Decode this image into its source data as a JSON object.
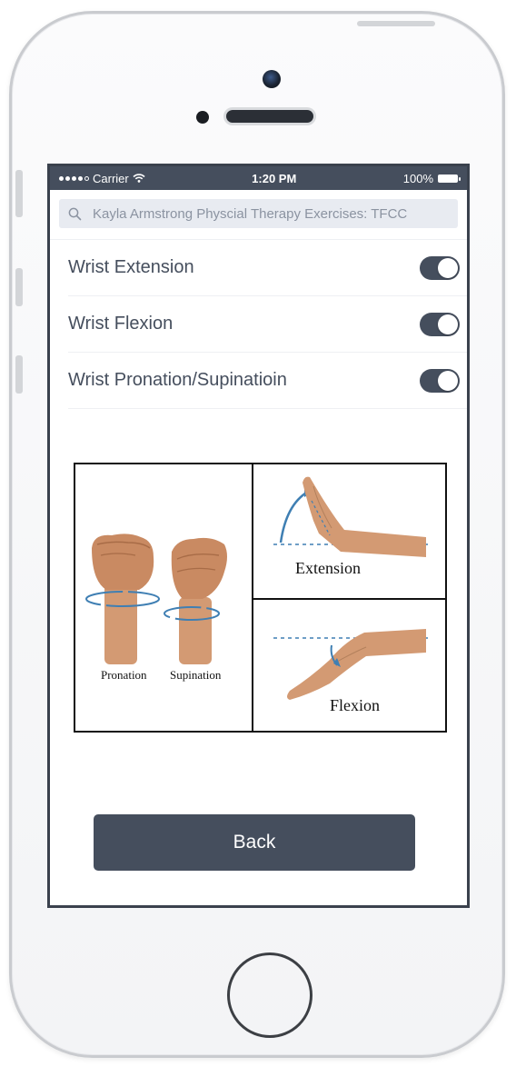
{
  "status_bar": {
    "carrier": "Carrier",
    "time": "1:20 PM",
    "battery": "100%"
  },
  "search": {
    "placeholder": "Kayla Armstrong Physcial Therapy Exercises: TFCC"
  },
  "exercises": [
    {
      "label": "Wrist Extension",
      "enabled": true
    },
    {
      "label": "Wrist Flexion",
      "enabled": true
    },
    {
      "label": "Wrist Pronation/Supinatioin",
      "enabled": true
    }
  ],
  "figure": {
    "pronation_label": "Pronation",
    "supination_label": "Supination",
    "extension_label": "Extension",
    "flexion_label": "Flexion"
  },
  "actions": {
    "back_label": "Back"
  },
  "colors": {
    "primary": "#454e5d",
    "search_bg": "#e8ebf1",
    "toggle_on": "#454e5d"
  }
}
